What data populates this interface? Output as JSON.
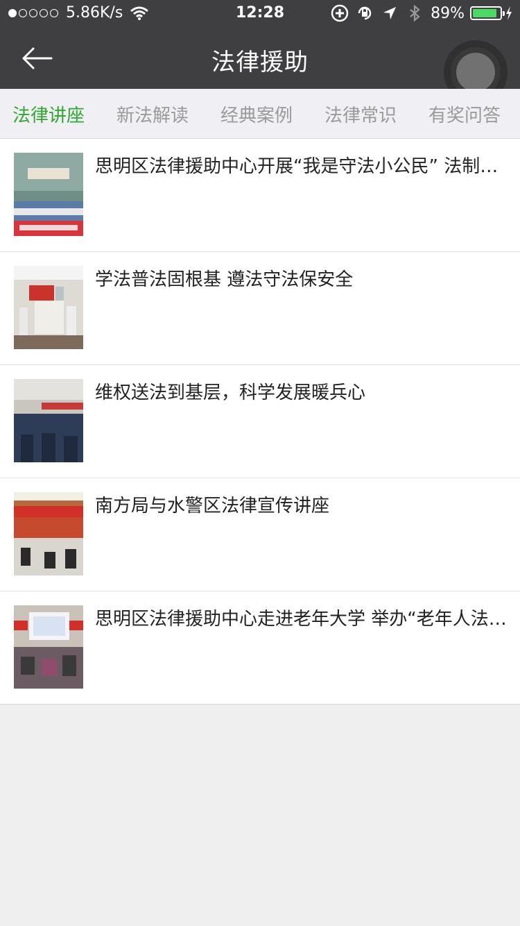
{
  "status_bar": {
    "network_speed": "5.86K/s",
    "time": "12:28",
    "battery_percent": "89%",
    "battery_level": 0.89,
    "signal_bars_filled": 1,
    "signal_bars_total": 5
  },
  "nav": {
    "title": "法律援助",
    "back_icon": "arrow-left-icon"
  },
  "tabs": [
    {
      "label": "法律讲座",
      "active": true
    },
    {
      "label": "新法解读",
      "active": false
    },
    {
      "label": "经典案例",
      "active": false
    },
    {
      "label": "法律常识",
      "active": false
    },
    {
      "label": "有奖问答",
      "active": false
    }
  ],
  "articles": [
    {
      "title": "思明区法律援助中心开展“我是守法小公民” 法制安全夏令营活动"
    },
    {
      "title": "学法普法固根基 遵法守法保安全"
    },
    {
      "title": "维权送法到基层，科学发展暖兵心"
    },
    {
      "title": "南方局与水警区法律宣传讲座"
    },
    {
      "title": "思明区法律援助中心走进老年大学 举办“老年人法律知识讲座”"
    }
  ],
  "colors": {
    "header_bg": "#3f3f41",
    "active_tab": "#2fa82f",
    "inactive_tab": "#9a9a9a",
    "battery_fill": "#4cd964"
  }
}
